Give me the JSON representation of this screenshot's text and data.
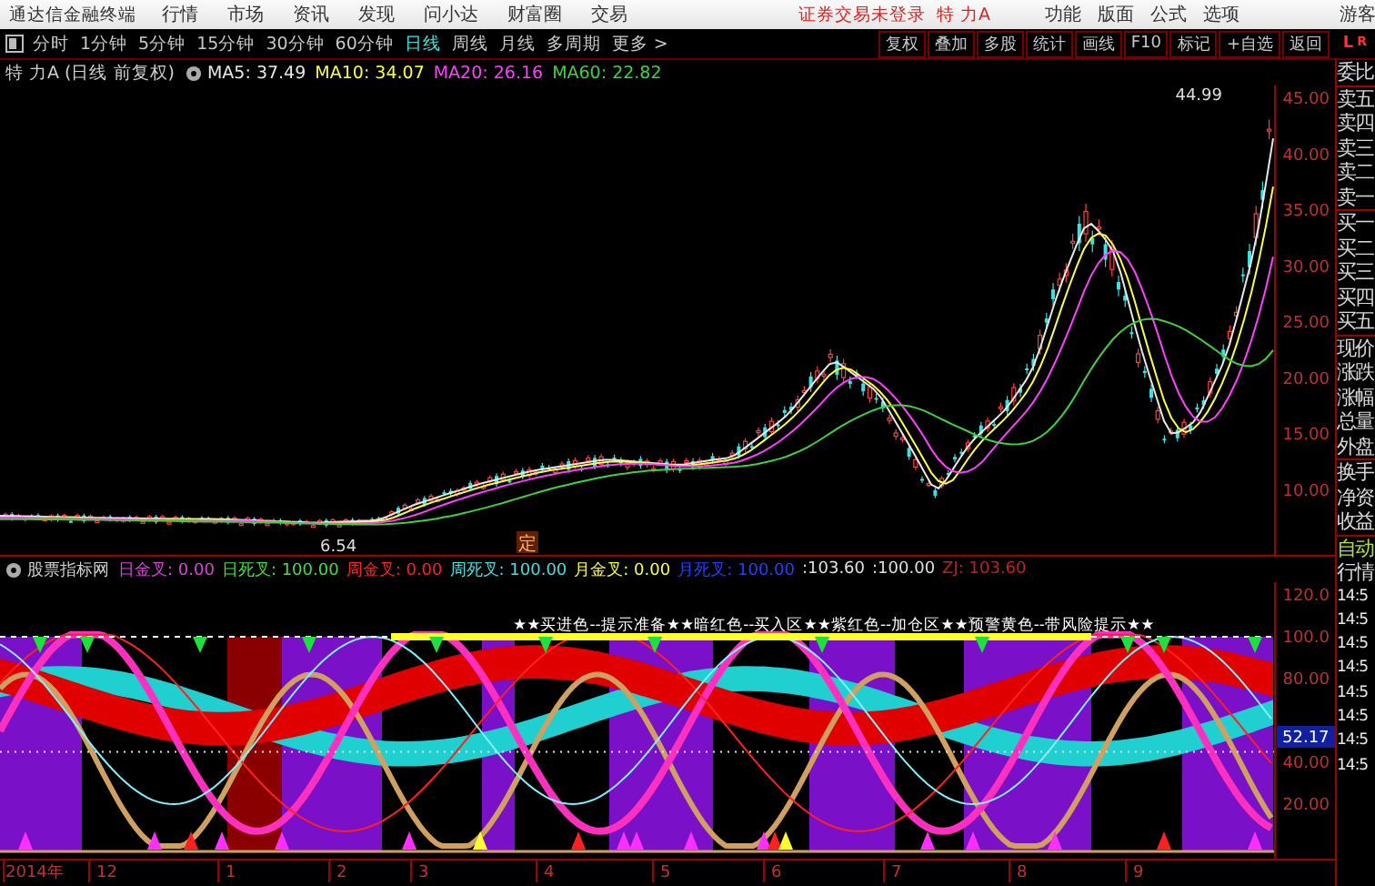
{
  "app": {
    "title": "通达信金融终端",
    "menu": [
      "行情",
      "市场",
      "资讯",
      "发现",
      "问小达",
      "财富圈",
      "交易"
    ],
    "notice": "证券交易未登录",
    "stock_tag": "特 力A",
    "right_menu": [
      "功能",
      "版面",
      "公式",
      "选项"
    ],
    "user": "游客"
  },
  "periods": [
    {
      "label": "分时",
      "selected": false
    },
    {
      "label": "1分钟",
      "selected": false
    },
    {
      "label": "5分钟",
      "selected": false
    },
    {
      "label": "15分钟",
      "selected": false
    },
    {
      "label": "30分钟",
      "selected": false
    },
    {
      "label": "60分钟",
      "selected": false
    },
    {
      "label": "日线",
      "selected": true
    },
    {
      "label": "周线",
      "selected": false
    },
    {
      "label": "月线",
      "selected": false
    },
    {
      "label": "多周期",
      "selected": false
    },
    {
      "label": "更多 >",
      "selected": false
    }
  ],
  "tools": [
    "复权",
    "叠加",
    "多股",
    "统计",
    "画线",
    "F10",
    "标记",
    "+自选",
    "返回"
  ],
  "chart": {
    "title": "特 力A (日线 前复权)",
    "ma": [
      {
        "label": "MA5: 37.49",
        "color": "#e8e8e8"
      },
      {
        "label": "MA10: 34.07",
        "color": "#ffff40"
      },
      {
        "label": "MA20: 26.16",
        "color": "#ff40ff"
      },
      {
        "label": "MA60: 22.82",
        "color": "#40d040"
      }
    ],
    "high_label": "44.99",
    "low_label": "6.54",
    "marker": "定",
    "y_labels": [
      "45.00",
      "40.00",
      "35.00",
      "30.00",
      "25.00",
      "20.00",
      "15.00",
      "10.00"
    ]
  },
  "indicator": {
    "name": "股票指标网",
    "values": [
      {
        "text": "日金叉: 0.00",
        "color": "#e040e0"
      },
      {
        "text": "日死叉: 100.00",
        "color": "#40e040"
      },
      {
        "text": "周金叉: 0.00",
        "color": "#ff2020"
      },
      {
        "text": "周死叉: 100.00",
        "color": "#40e0e0"
      },
      {
        "text": "月金叉: 0.00",
        "color": "#ffff40"
      },
      {
        "text": "月死叉: 100.00",
        "color": "#2040ff"
      },
      {
        "text": ":103.60",
        "color": "#e0e0e0"
      },
      {
        "text": ":100.00",
        "color": "#e0e0e0"
      },
      {
        "text": "ZJ: 103.60",
        "color": "#c02020"
      }
    ],
    "banner": "★★买进色--提示准备★★暗红色--买入区★★紫红色--加仓区★★预警黄色--带风险提示★★",
    "y_labels": [
      "120.0",
      "100.0",
      "80.00",
      "40.00",
      "20.00"
    ],
    "current": "52.17"
  },
  "x_labels": [
    "2014年",
    "12",
    "1",
    "2",
    "3",
    "4",
    "5",
    "6",
    "7",
    "8",
    "9"
  ],
  "side_panel": {
    "corner": [
      "L",
      "R"
    ],
    "groups": [
      [
        "委比"
      ],
      [
        "卖五",
        "卖四",
        "卖三",
        "卖二",
        "卖一"
      ],
      [
        "买一",
        "买二",
        "买三",
        "买四",
        "买五"
      ],
      [
        "现价",
        "涨跌",
        "涨幅",
        "总量",
        "外盘"
      ],
      [
        "换手",
        "净资",
        "收益"
      ]
    ],
    "mode": "自动",
    "section": "行情",
    "times": [
      "14:5",
      "14:5",
      "14:5",
      "14:5",
      "14:5",
      "14:5",
      "14:5",
      "14:5"
    ]
  }
}
